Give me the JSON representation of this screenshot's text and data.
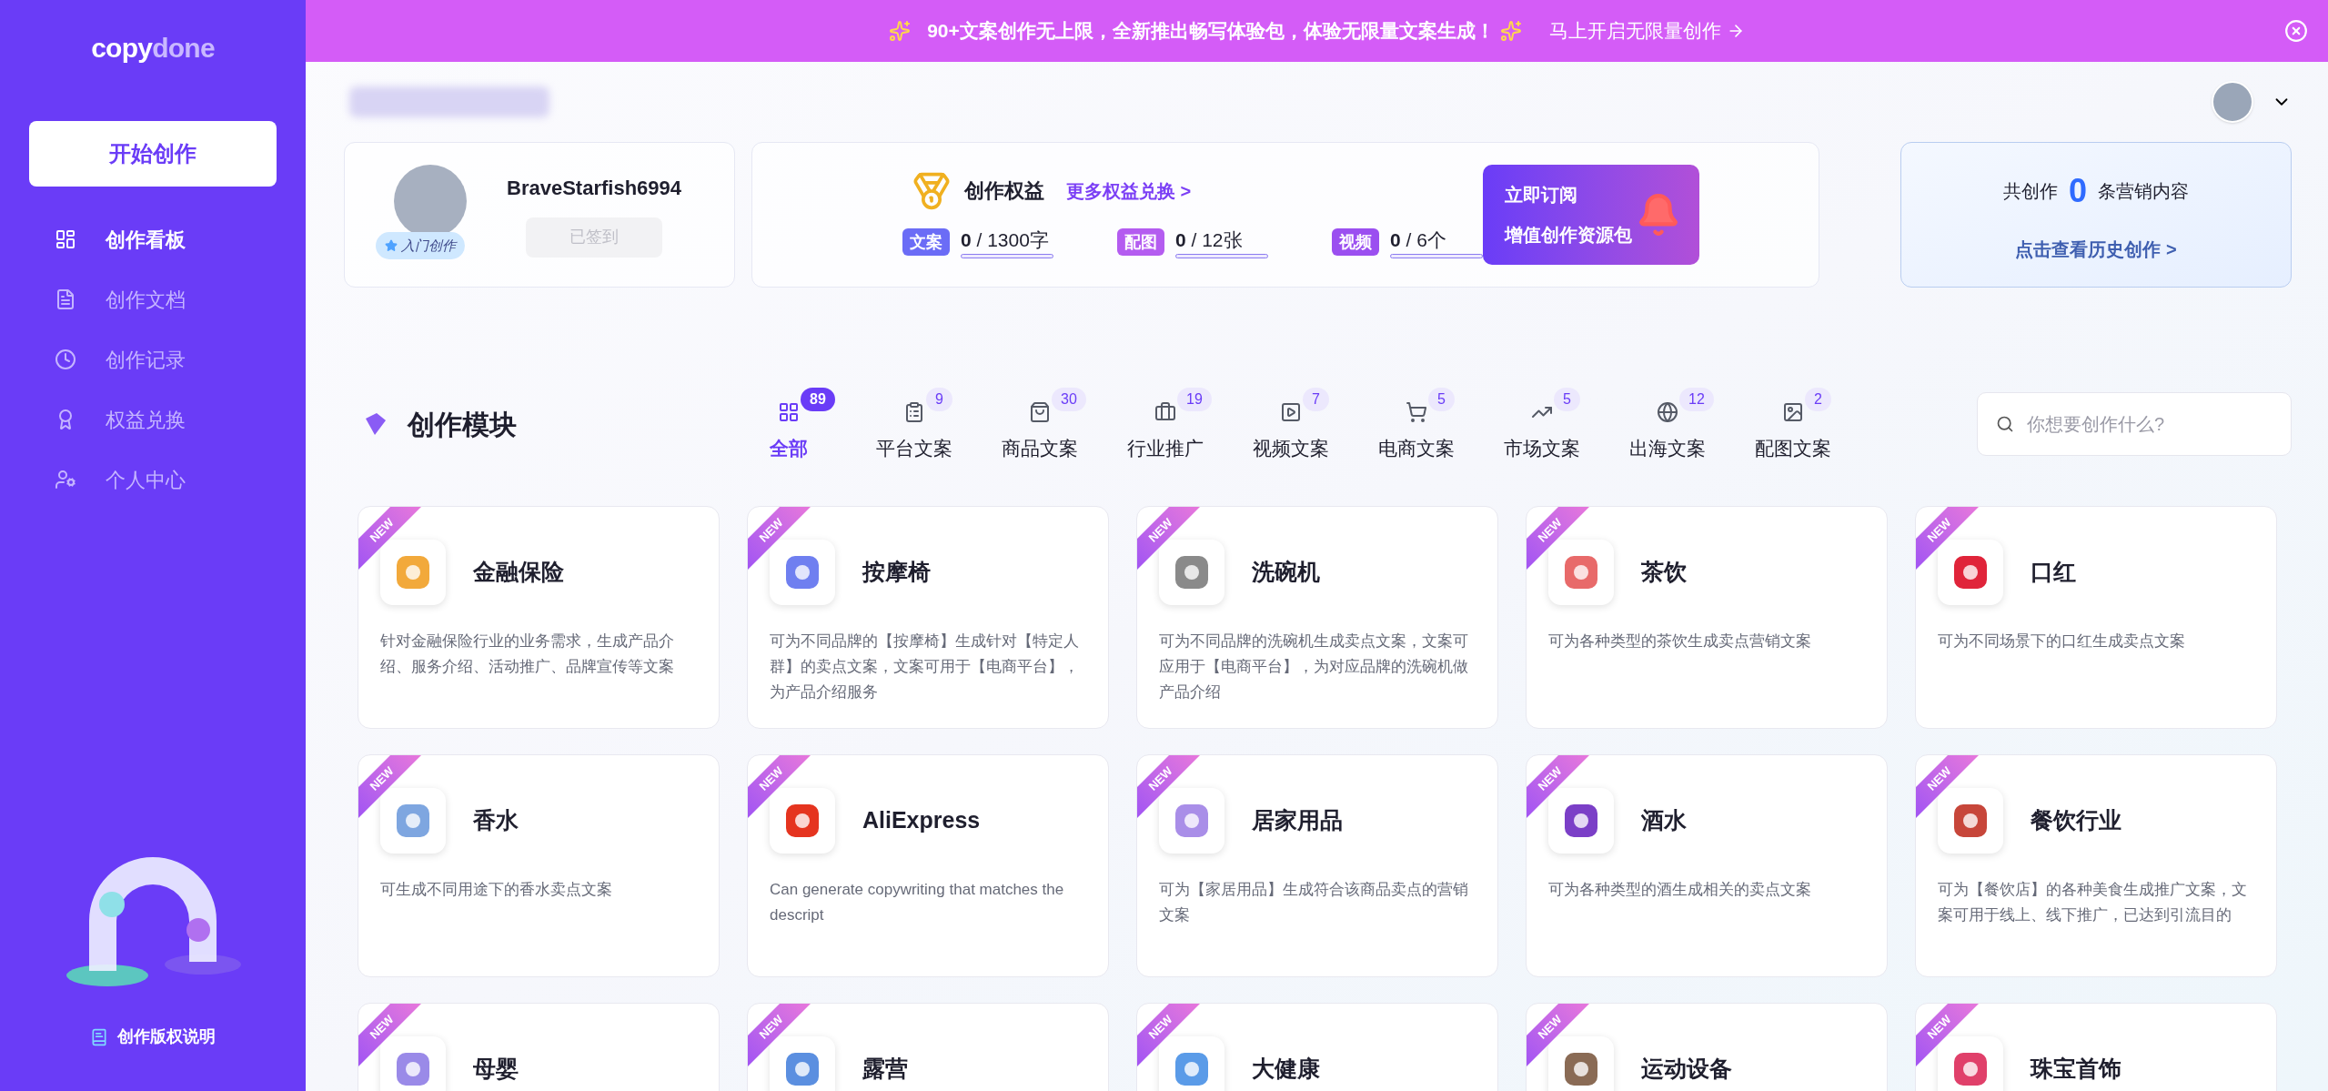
{
  "sidebar": {
    "logo": {
      "part_1": "copy",
      "part_2": "done"
    },
    "start_button": "开始创作",
    "items": [
      {
        "label": "创作看板",
        "selected": true
      },
      {
        "label": "创作文档",
        "selected": false
      },
      {
        "label": "创作记录",
        "selected": false
      },
      {
        "label": "权益兑换",
        "selected": false
      },
      {
        "label": "个人中心",
        "selected": false
      }
    ],
    "footer_link": "创作版权说明"
  },
  "banner": {
    "text": "90+文案创作无上限，全新推出畅写体验包，体验无限量文案生成！",
    "link": "马上开启无限量创作"
  },
  "profile": {
    "username": "BraveStarfish6994",
    "level_badge": "入门创作",
    "checkin_button": {
      "label": "已签到",
      "disabled": true
    }
  },
  "benefits": {
    "title": "创作权益",
    "more_link": "更多权益兑换 >",
    "subscribe": {
      "line_1": "立即订阅",
      "line_2": "增值创作资源包"
    },
    "quotas": [
      {
        "tag": "文案",
        "used": "0",
        "total": " / 1300字",
        "level": 0,
        "color": "#6b6cf6"
      },
      {
        "tag": "配图",
        "used": "0",
        "total": " / 12张",
        "level": 0,
        "color": "#b45cf0"
      },
      {
        "tag": "视频",
        "used": "0",
        "total": " / 6个",
        "level": 0,
        "color": "#9b4ff0"
      }
    ]
  },
  "history": {
    "prefix": "共创作",
    "count": "0",
    "suffix": "条营销内容",
    "link": "点击查看历史创作 >"
  },
  "modules": {
    "title": "创作模块",
    "search": {
      "placeholder": "你想要创作什么?"
    },
    "tabs": [
      {
        "label": "全部",
        "count": "89",
        "selected": true
      },
      {
        "label": "平台文案",
        "count": "9",
        "selected": false
      },
      {
        "label": "商品文案",
        "count": "30",
        "selected": false
      },
      {
        "label": "行业推广",
        "count": "19",
        "selected": false
      },
      {
        "label": "视频文案",
        "count": "7",
        "selected": false
      },
      {
        "label": "电商文案",
        "count": "5",
        "selected": false
      },
      {
        "label": "市场文案",
        "count": "5",
        "selected": false
      },
      {
        "label": "出海文案",
        "count": "12",
        "selected": false
      },
      {
        "label": "配图文案",
        "count": "2",
        "selected": false
      }
    ],
    "cards": [
      {
        "badge": "NEW",
        "title": "金融保险",
        "description": "针对金融保险行业的业务需求，生成产品介绍、服务介绍、活动推广、品牌宣传等文案",
        "color": "#f2a93b"
      },
      {
        "badge": "NEW",
        "title": "按摩椅",
        "description": "可为不同品牌的【按摩椅】生成针对【特定人群】的卖点文案，文案可用于【电商平台】，为产品介绍服务",
        "color": "#6f7ff0"
      },
      {
        "badge": "NEW",
        "title": "洗碗机",
        "description": "可为不同品牌的洗碗机生成卖点文案，文案可应用于【电商平台】，为对应品牌的洗碗机做产品介绍",
        "color": "#8a8a8a"
      },
      {
        "badge": "NEW",
        "title": "茶饮",
        "description": "可为各种类型的茶饮生成卖点营销文案",
        "color": "#e86a6a"
      },
      {
        "badge": "NEW",
        "title": "口红",
        "description": "可为不同场景下的口红生成卖点文案",
        "color": "#e0243a"
      },
      {
        "badge": "NEW",
        "title": "香水",
        "description": "可生成不同用途下的香水卖点文案",
        "color": "#7ea6e0"
      },
      {
        "badge": "NEW",
        "title": "AliExpress",
        "description": "Can generate copywriting that matches the descript",
        "color": "#e5341f"
      },
      {
        "badge": "NEW",
        "title": "居家用品",
        "description": "可为【家居用品】生成符合该商品卖点的营销文案",
        "color": "#a98ee8"
      },
      {
        "badge": "NEW",
        "title": "酒水",
        "description": "可为各种类型的酒生成相关的卖点文案",
        "color": "#7b3fc7"
      },
      {
        "badge": "NEW",
        "title": "餐饮行业",
        "description": "可为【餐饮店】的各种美食生成推广文案，文案可用于线上、线下推广，已达到引流目的",
        "color": "#c7463a"
      },
      {
        "badge": "NEW",
        "title": "母婴",
        "color": "#9a8ae8"
      },
      {
        "badge": "NEW",
        "title": "露营",
        "color": "#5b8fe0"
      },
      {
        "badge": "NEW",
        "title": "大健康",
        "color": "#5a9be8"
      },
      {
        "badge": "NEW",
        "title": "运动设备",
        "color": "#8a6b55"
      },
      {
        "badge": "NEW",
        "title": "珠宝首饰",
        "color": "#e0406a"
      }
    ]
  }
}
